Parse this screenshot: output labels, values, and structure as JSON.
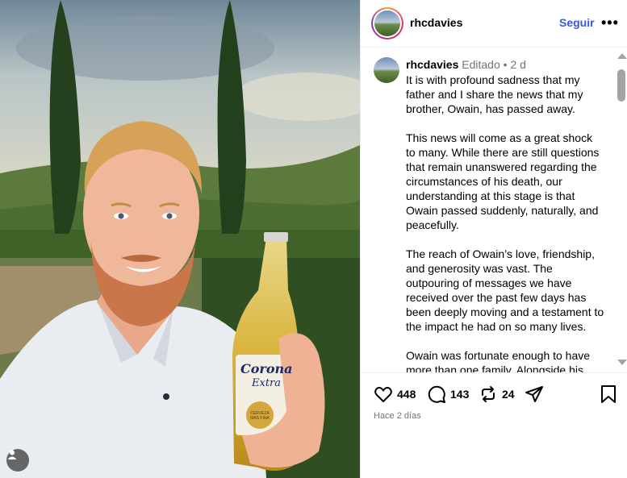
{
  "post": {
    "username": "rhcdavies",
    "follow_label": "Seguir",
    "more_label": "•••"
  },
  "caption": {
    "username": "rhcdavies",
    "edited": "Editado",
    "separator": "•",
    "age": "2 d",
    "paragraphs": [
      "It is with profound sadness that my father and I share the news that my brother, Owain, has passed away.",
      "This news will come as a great shock to many. While there are still questions that remain unanswered regarding the circumstances of his death, our understanding at this stage is that Owain passed suddenly, naturally, and peacefully.",
      "The reach of Owain’s love, friendship, and generosity was vast. The outpouring of messages we have received over the past few days has been deeply moving and a testament to the impact he had on so many lives.",
      "Owain was fortunate enough to have more than one family. Alongside his"
    ]
  },
  "actions": {
    "likes": "448",
    "comments": "143",
    "reposts": "24",
    "timestamp": "Hace 2 días"
  },
  "photo": {
    "bottle_label_top": "Corona",
    "bottle_label_sub": "Extra",
    "bottle_label_seal": "CERVEZA MAS FINA"
  },
  "icons": [
    "person-tag-icon",
    "heart-icon",
    "comment-icon",
    "repost-icon",
    "share-icon",
    "bookmark-icon"
  ],
  "colors": {
    "follow": "#3a5ad1",
    "meta": "#737373",
    "border": "#efefef"
  }
}
